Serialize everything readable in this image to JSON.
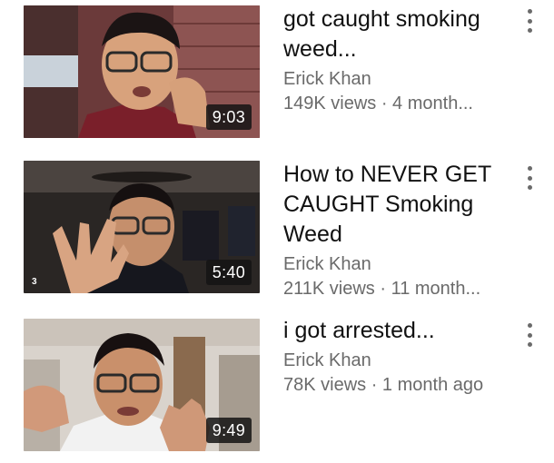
{
  "videos": [
    {
      "title": "got caught smoking weed...",
      "channel": "Erick Khan",
      "stats": "149K views · 4 month...",
      "duration": "9:03"
    },
    {
      "title": "How to NEVER GET CAUGHT Smoking Weed",
      "channel": "Erick Khan",
      "stats": "211K views · 11 month...",
      "duration": "5:40",
      "corner_mark": "3"
    },
    {
      "title": "i got arrested...",
      "channel": "Erick Khan",
      "stats": "78K views · 1 month ago",
      "duration": "9:49"
    }
  ],
  "icons": {
    "more": "kebab-menu-icon"
  }
}
